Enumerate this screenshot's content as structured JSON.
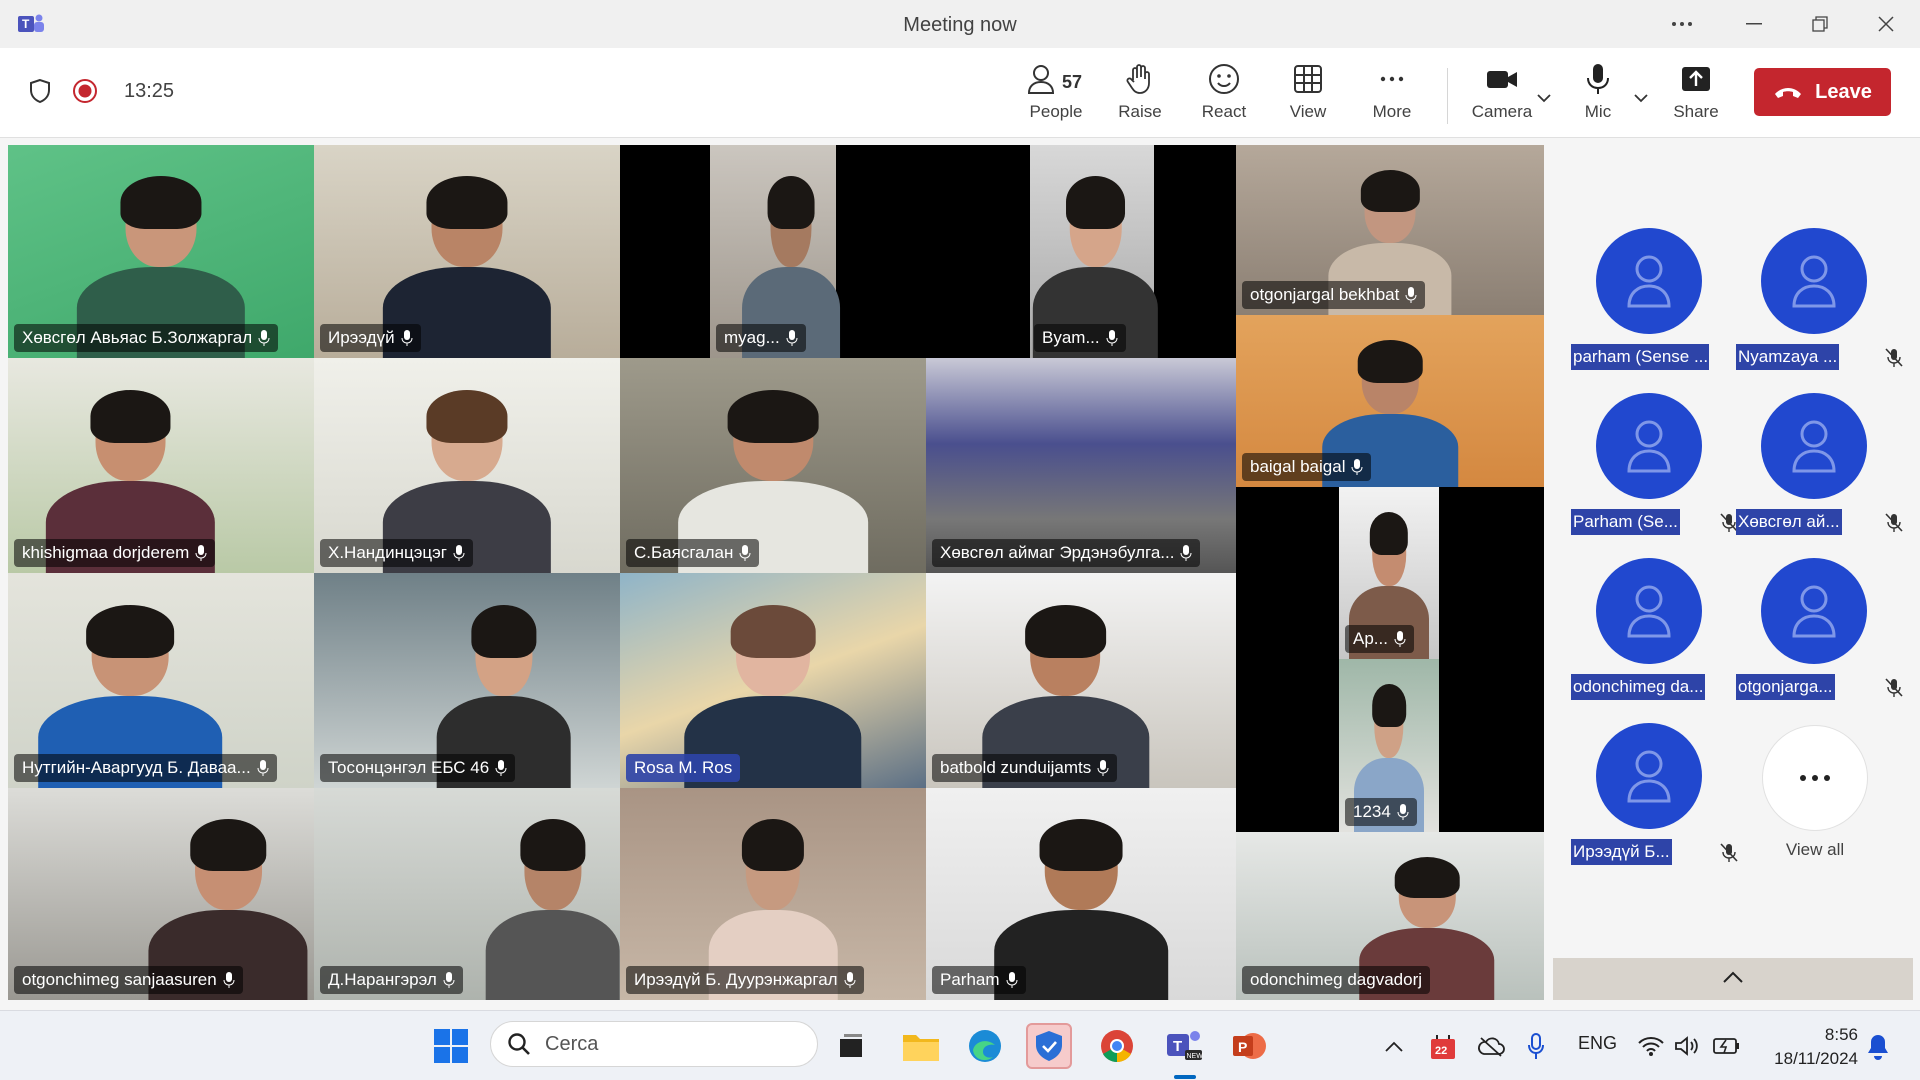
{
  "window": {
    "title": "Meeting now"
  },
  "toolbar": {
    "timer": "13:25",
    "people_count": "57",
    "people_label": "People",
    "raise_label": "Raise",
    "react_label": "React",
    "view_label": "View",
    "more_label": "More",
    "camera_label": "Camera",
    "mic_label": "Mic",
    "share_label": "Share",
    "leave_label": "Leave"
  },
  "tiles": [
    {
      "name": "Хөвсгөл Авьяас Б.Золжаргал"
    },
    {
      "name": "Ирээдүй"
    },
    {
      "name": "myag..."
    },
    {
      "name": "Byam..."
    },
    {
      "name": "otgonjargal bekhbat"
    },
    {
      "name": "khishigmaa dorjderem"
    },
    {
      "name": "Х.Нандинцэцэг"
    },
    {
      "name": "С.Баясгалан"
    },
    {
      "name": "Хөвсгөл аймаг Эрдэнэбулга..."
    },
    {
      "name": "baigal baigal"
    },
    {
      "name": "Ар..."
    },
    {
      "name": "Нутгийн-Аваргууд Б. Даваа..."
    },
    {
      "name": "Тосонцэнгэл ЕБС 46"
    },
    {
      "name": "Rosa M. Ros"
    },
    {
      "name": "batbold zunduijamts"
    },
    {
      "name": "1234"
    },
    {
      "name": "otgonchimeg sanjaasuren"
    },
    {
      "name": "Д.Нарангэрэл"
    },
    {
      "name": "Ирээдүй Б. Дуурэнжаргал"
    },
    {
      "name": "Parham"
    },
    {
      "name": "odonchimeg dagvadorj"
    }
  ],
  "side_panel": {
    "participants": [
      {
        "name": "parham (Sense ..."
      },
      {
        "name": "Nyamzaya ..."
      },
      {
        "name": "Parham (Se..."
      },
      {
        "name": "Хөвсгөл ай..."
      },
      {
        "name": "odonchimeg da..."
      },
      {
        "name": "otgonjarga..."
      },
      {
        "name": "Ирээдүй Б..."
      }
    ],
    "view_all_label": "View all"
  },
  "taskbar": {
    "search_placeholder": "Cerca",
    "language": "ENG",
    "time": "8:56",
    "date": "18/11/2024",
    "calendar_badge": "22"
  },
  "colors": {
    "leave": "#c4262e",
    "avatar": "#2148cf",
    "highlight": "#2e44a8"
  }
}
